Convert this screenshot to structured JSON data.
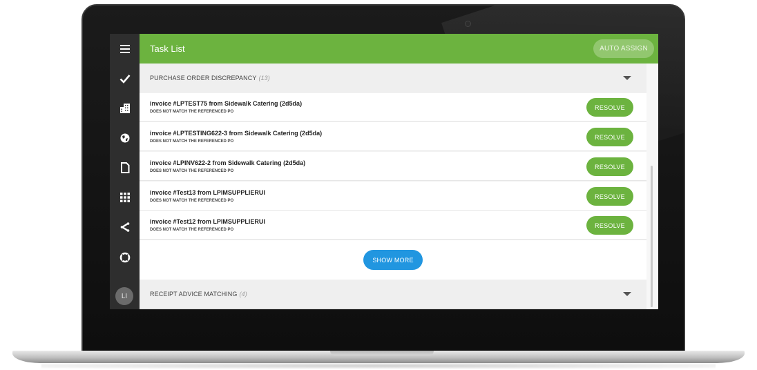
{
  "app": {
    "title": "Task List",
    "auto_assign_label": "AUTO ASSIGN"
  },
  "sidebar": {
    "items": [
      {
        "name": "menu",
        "icon": "hamburger-icon"
      },
      {
        "name": "tasks",
        "icon": "checkmark-icon"
      },
      {
        "name": "buildings",
        "icon": "building-icon"
      },
      {
        "name": "globe",
        "icon": "globe-icon"
      },
      {
        "name": "documents",
        "icon": "document-icon"
      },
      {
        "name": "apps",
        "icon": "grid-icon"
      },
      {
        "name": "share",
        "icon": "share-icon"
      },
      {
        "name": "help",
        "icon": "lifebuoy-icon"
      }
    ],
    "avatar_initials": "LI"
  },
  "sections": [
    {
      "title": "PURCHASE ORDER DISCREPANCY",
      "count": "(13)",
      "tasks": [
        {
          "title": "invoice #LPTEST75 from Sidewalk Catering (2d5da)",
          "subtitle": "DOES NOT MATCH THE REFERENCED PO",
          "action": "RESOLVE"
        },
        {
          "title": "invoice #LPTESTING622-3 from Sidewalk Catering (2d5da)",
          "subtitle": "DOES NOT MATCH THE REFERENCED PO",
          "action": "RESOLVE"
        },
        {
          "title": "invoice #LPINV622-2 from Sidewalk Catering (2d5da)",
          "subtitle": "DOES NOT MATCH THE REFERENCED PO",
          "action": "RESOLVE"
        },
        {
          "title": "invoice #Test13 from LPIMSUPPLIERUI",
          "subtitle": "DOES NOT MATCH THE REFERENCED PO",
          "action": "RESOLVE"
        },
        {
          "title": "invoice #Test12 from LPIMSUPPLIERUI",
          "subtitle": "DOES NOT MATCH THE REFERENCED PO",
          "action": "RESOLVE"
        }
      ],
      "show_more_label": "SHOW MORE"
    },
    {
      "title": "RECEIPT ADVICE MATCHING",
      "count": "(4)"
    }
  ],
  "colors": {
    "accent_green": "#6cb33f",
    "button_blue": "#2196e0",
    "sidebar_dark": "#2e2e2e"
  }
}
